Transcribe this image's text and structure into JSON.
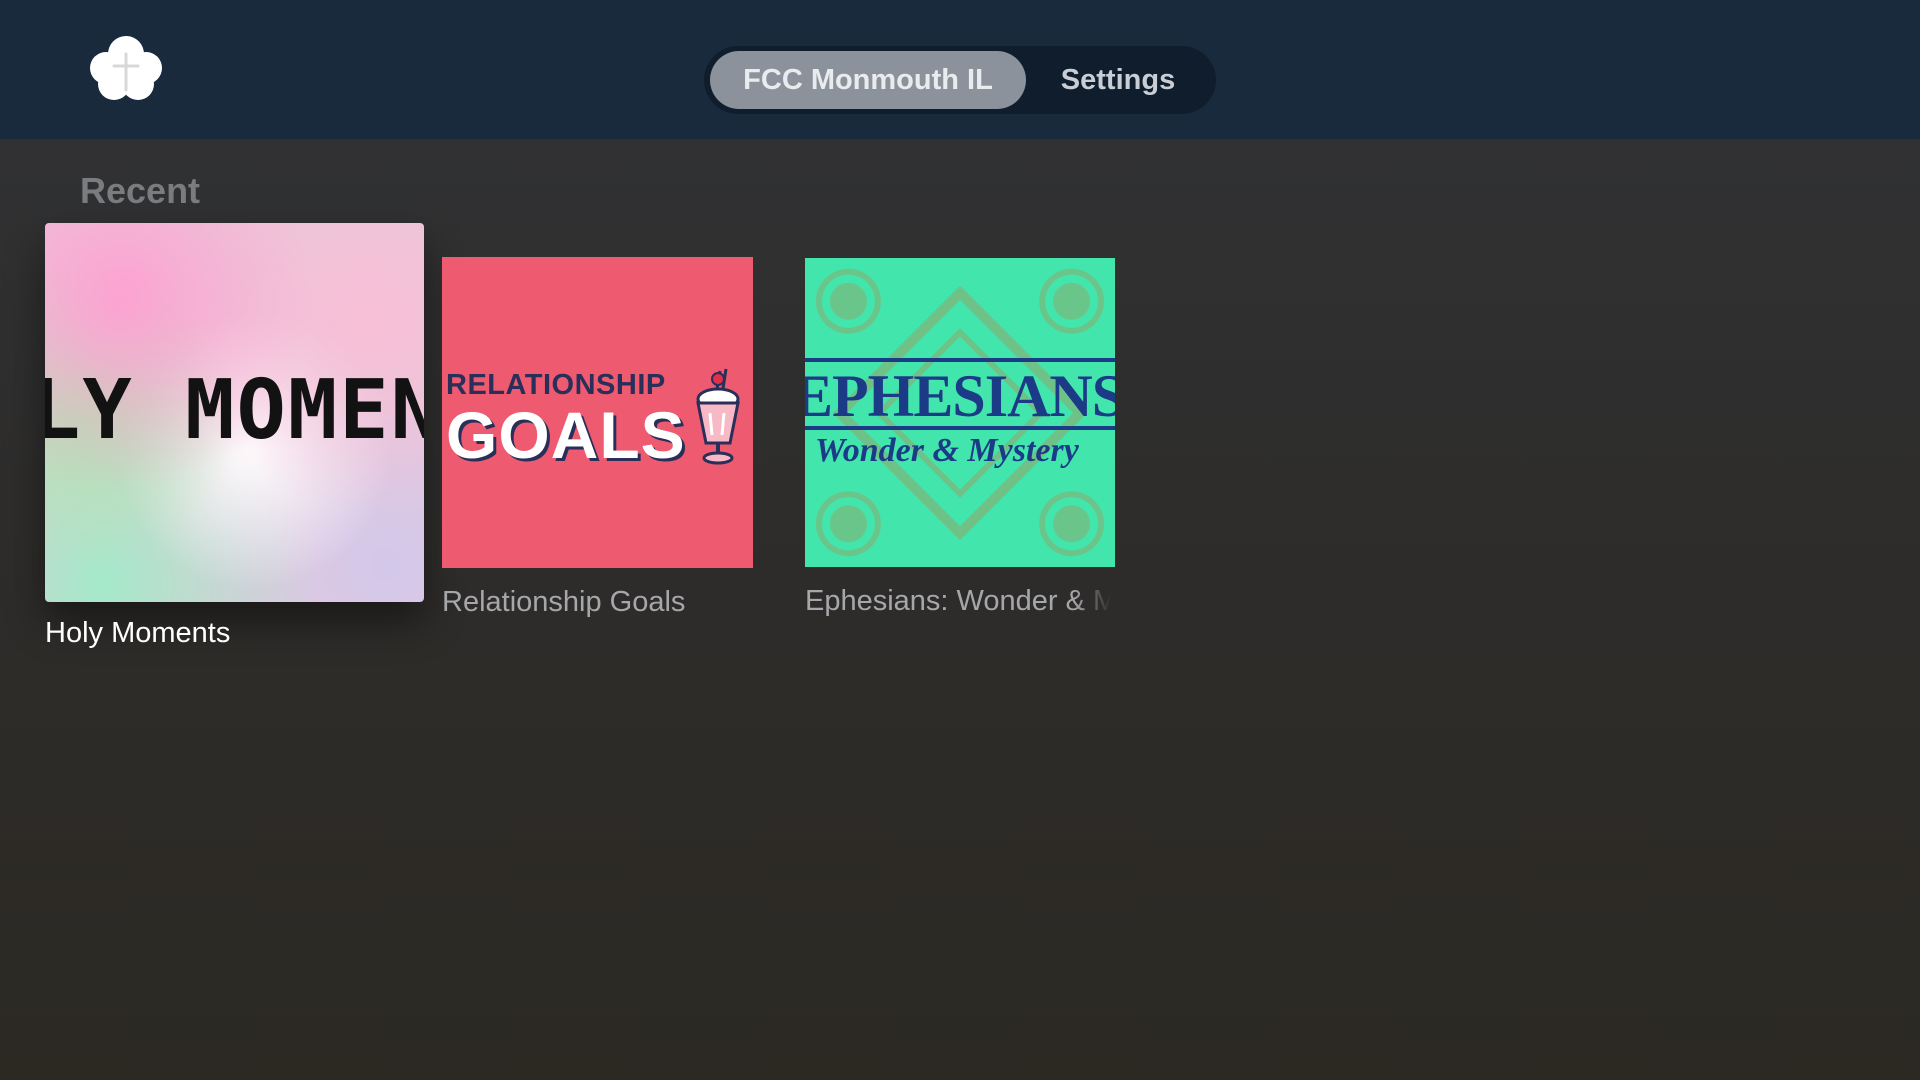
{
  "header": {
    "logo_icon": "cloud-cross-icon",
    "tabs": [
      {
        "label": "FCC Monmouth IL",
        "active": true
      },
      {
        "label": "Settings",
        "active": false
      }
    ]
  },
  "recent": {
    "title": "Recent",
    "items": [
      {
        "title": "Holy Moments",
        "artwork_text": "LY MOMEN",
        "focused": true
      },
      {
        "title": "Relationship Goals",
        "artwork_text_small": "RELATIONSHIP",
        "artwork_text_large": "GOALS",
        "artwork_icon": "milkshake-icon",
        "focused": false
      },
      {
        "title": "Ephesians: Wonder & Mystery",
        "artwork_title": "EPHESIANS",
        "artwork_subtitle": "Wonder & Mystery",
        "focused": false
      }
    ]
  },
  "colors": {
    "header_bg": "#1a2a3d",
    "active_tab_bg": "#8b929b",
    "relationship_bg": "#ee5a6f",
    "ephesians_bg": "#42e6ad",
    "ephesians_ink": "#1b3b86"
  }
}
